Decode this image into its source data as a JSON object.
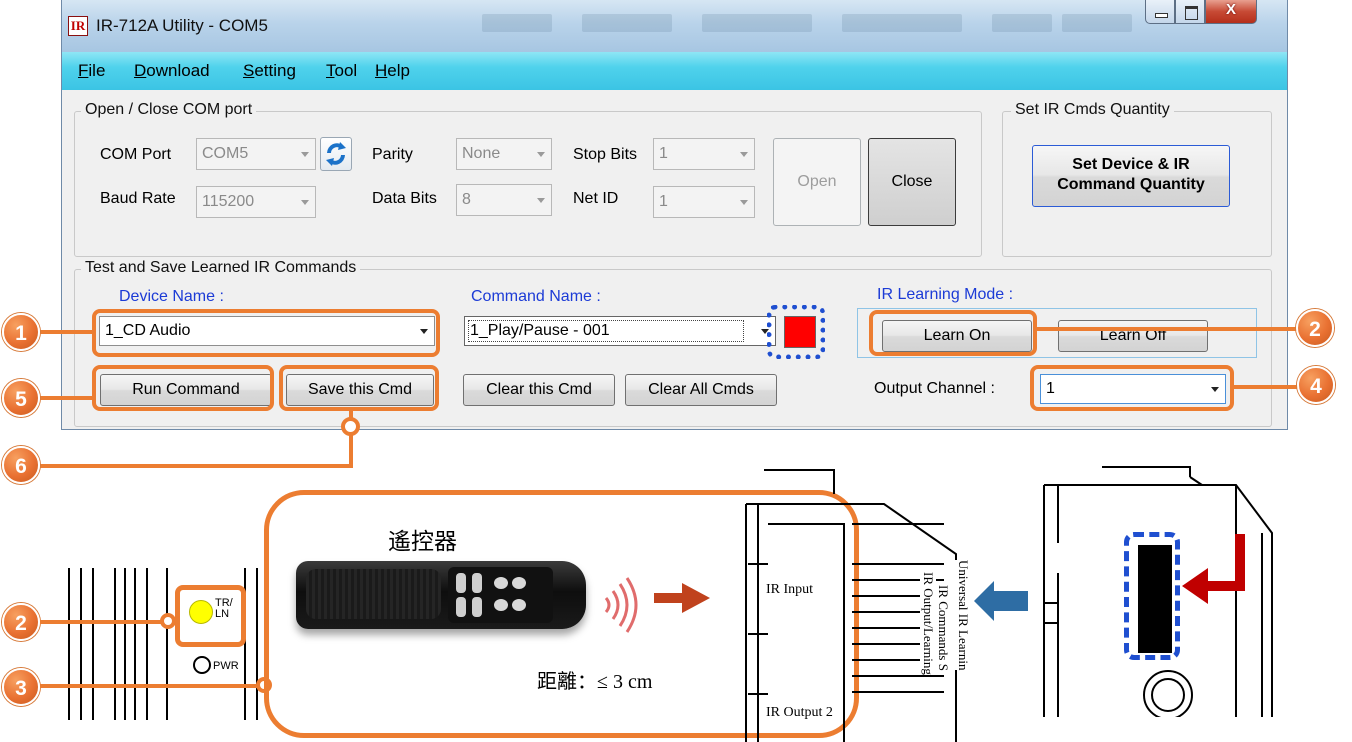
{
  "window": {
    "app_icon": "IR",
    "title": "IR-712A Utility - COM5",
    "close_glyph": "X"
  },
  "menu": [
    {
      "first": "F",
      "rest": "ile"
    },
    {
      "first": "D",
      "rest": "ownload"
    },
    {
      "first": "S",
      "rest": "etting"
    },
    {
      "first": "T",
      "rest": "ool"
    },
    {
      "first": "H",
      "rest": "elp"
    }
  ],
  "com_group": {
    "legend": "Open / Close COM port",
    "com_port_label": "COM Port",
    "com_port_value": "COM5",
    "parity_label": "Parity",
    "parity_value": "None",
    "stop_bits_label": "Stop Bits",
    "stop_bits_value": "1",
    "baud_rate_label": "Baud Rate",
    "baud_rate_value": "115200",
    "data_bits_label": "Data Bits",
    "data_bits_value": "8",
    "net_id_label": "Net ID",
    "net_id_value": "1",
    "open_label": "Open",
    "close_label": "Close"
  },
  "qty_group": {
    "legend": "Set IR Cmds Quantity",
    "button_line1": "Set Device & IR",
    "button_line2": "Command Quantity"
  },
  "test_group": {
    "legend": "Test and Save Learned IR Commands",
    "device_name_label": "Device Name :",
    "device_name_value": "1_CD Audio",
    "command_name_label": "Command Name :",
    "command_name_value": "1_Play/Pause - 001",
    "learning_mode_label": "IR Learning Mode :",
    "learn_on_label": "Learn On",
    "learn_off_label": "Learn Off",
    "run_command_label": "Run Command",
    "save_cmd_label": "Save this Cmd",
    "clear_cmd_label": "Clear this Cmd",
    "clear_all_label": "Clear All Cmds",
    "output_channel_label": "Output Channel :",
    "output_channel_value": "1",
    "status_color": "#ff0000"
  },
  "badges": [
    "1",
    "2",
    "4",
    "5",
    "6",
    "2",
    "3"
  ],
  "illustration": {
    "remote_label": "遙控器",
    "distance_label": "距離：≤ 3 cm",
    "tr_ln_label_1": "TR/",
    "tr_ln_label_2": "LN",
    "pwr_label": "PWR",
    "ir_input_label": "IR Input",
    "ir_output_label": "IR Output 2",
    "side_text_1": "Universal IR Learnin",
    "side_text_2": "IR Output/Learning",
    "side_text_3": "IR Commands S"
  },
  "colors": {
    "annotation_orange": "#ec7d31",
    "dotted_blue": "#1f4fd0",
    "led_yellow": "#ffff00",
    "arrow_red": "#c00000",
    "arrow_blue": "#2e6da4"
  }
}
